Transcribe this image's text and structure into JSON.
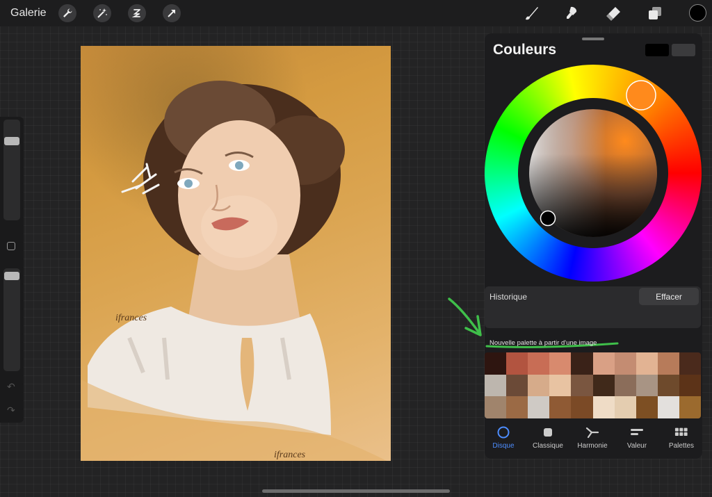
{
  "topbar": {
    "gallery_label": "Galerie"
  },
  "colors_panel": {
    "title": "Couleurs",
    "history_label": "Historique",
    "clear_label": "Effacer",
    "new_palette_label": "Nouvelle palette à partir d'une image",
    "palette": [
      "#2e1510",
      "#b25440",
      "#c86d55",
      "#d88a6e",
      "#3a2218",
      "#d9a085",
      "#c48c72",
      "#e2b393",
      "#b77b5a",
      "#4a2a1c",
      "#bdb6ae",
      "#6b4a37",
      "#d6ab8a",
      "#e8c3a2",
      "#7a5640",
      "#40291a",
      "#8b6d5a",
      "#a89484",
      "#6e4a2c",
      "#5c3318",
      "#a0846c",
      "#9b6a45",
      "#cfcac5",
      "#8f5a34",
      "#7b4a26",
      "#efdcc6",
      "#e4cdb0",
      "#7d4f23",
      "#e3e0dd",
      "#9b6a2e"
    ]
  },
  "tabs": [
    {
      "label": "Disque"
    },
    {
      "label": "Classique"
    },
    {
      "label": "Harmonie"
    },
    {
      "label": "Valeur"
    },
    {
      "label": "Palettes"
    }
  ],
  "accent_color": "#4d8dff",
  "selected_color": "#ff8a1c",
  "current_color": "#000000"
}
